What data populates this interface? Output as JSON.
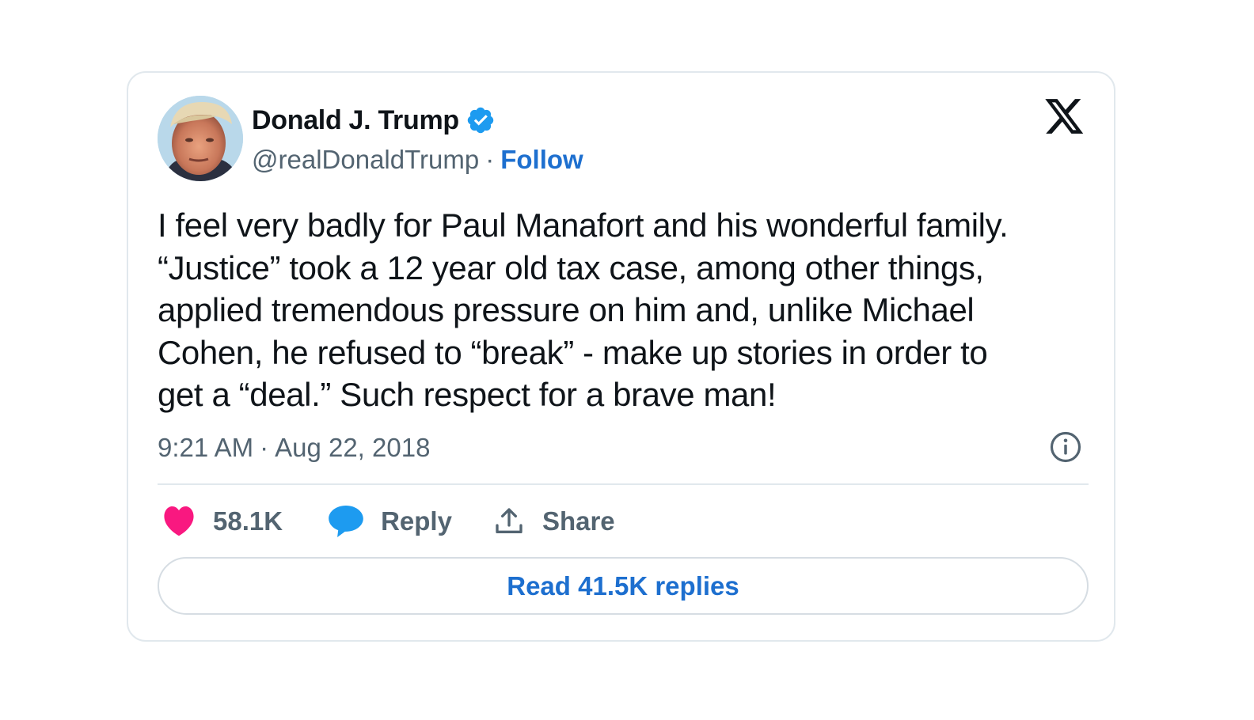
{
  "tweet": {
    "author": {
      "display_name": "Donald J. Trump",
      "handle": "@realDonaldTrump",
      "verified": true,
      "avatar_icon": "profile-photo"
    },
    "follow_label": "Follow",
    "separator": "·",
    "text_lines": [
      "I feel very badly for Paul Manafort and his wonderful family.",
      "“Justice” took a 12 year old tax case, among other things,",
      "applied tremendous pressure on him and, unlike Michael",
      "Cohen, he refused to “break” - make up stories in order to",
      "get a “deal.” Such respect for a brave man!"
    ],
    "time": "9:21 AM",
    "date": "Aug 22, 2018",
    "actions": {
      "likes": "58.1K",
      "reply_label": "Reply",
      "share_label": "Share"
    },
    "read_replies_label": "Read 41.5K replies"
  },
  "colors": {
    "text_primary": "#0f1419",
    "text_secondary": "#536471",
    "link_blue": "#1d6fcf",
    "verified_blue": "#1d9bf0",
    "like_pink": "#f91880",
    "border": "#e1e8ed"
  },
  "icons": [
    "verified-badge-icon",
    "x-logo-icon",
    "info-icon",
    "heart-icon",
    "speech-bubble-icon",
    "share-icon"
  ]
}
